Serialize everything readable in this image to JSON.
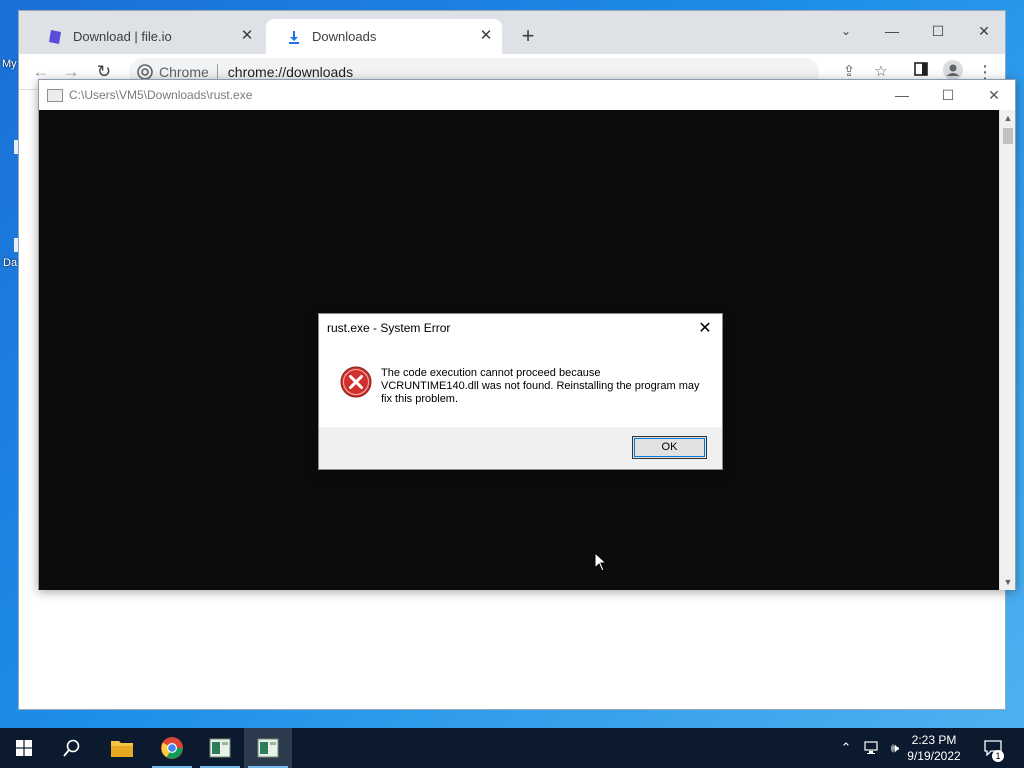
{
  "desktop": {
    "fragment_1": "My",
    "fragment_2": "Da"
  },
  "browser": {
    "tabs": [
      {
        "title": "Download | file.io",
        "icon": "fileio-favicon",
        "active": false
      },
      {
        "title": "Downloads",
        "icon": "download-icon",
        "active": true
      }
    ],
    "omnibox": {
      "site_label": "Chrome",
      "url": "chrome://downloads"
    }
  },
  "console_window": {
    "title": "C:\\Users\\VM5\\Downloads\\rust.exe"
  },
  "dialog": {
    "title": "rust.exe - System Error",
    "message": "The code execution cannot proceed because VCRUNTIME140.dll was not found. Reinstalling the program may fix this problem.",
    "ok_label": "OK",
    "icon": "error-icon"
  },
  "taskbar": {
    "apps": [
      "start-button",
      "search-button",
      "file-explorer",
      "chrome",
      "notepad-1",
      "notepad-2"
    ],
    "clock": {
      "time": "2:23 PM",
      "date": "9/19/2022"
    },
    "notification_count": "1"
  },
  "colors": {
    "desktop": "#1e8ee8",
    "taskbar": "#0b1a2e",
    "console_bg": "#0c0c0c",
    "error_red": "#d0312d",
    "accent": "#1a73e8"
  }
}
